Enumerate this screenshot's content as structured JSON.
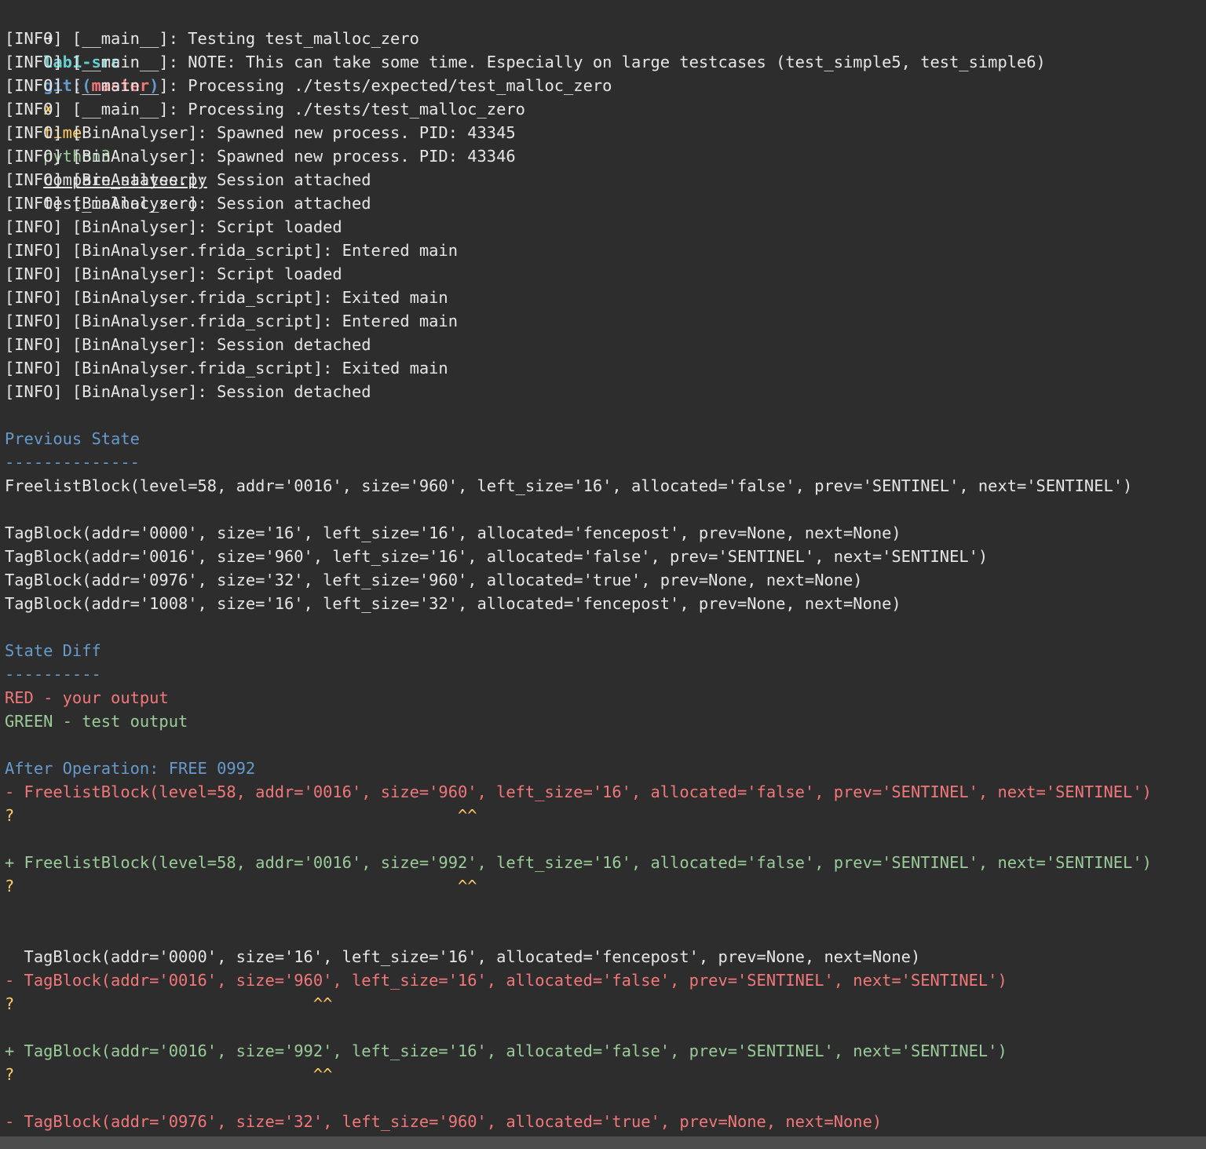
{
  "colors": {
    "background": "#2d2d2d",
    "text": "#e6e6e6",
    "heading_blue": "#6699cc",
    "diff_red": "#f2777a",
    "diff_green": "#99cc99",
    "hint_yellow": "#ffcc66",
    "prompt_cyan": "#66cccc",
    "git_blue": "#6699cc",
    "git_red": "#f2777a",
    "command_yellow": "#ffcc66",
    "python_green": "#99cc99",
    "bottom_bar": "#4d4d4d"
  },
  "prompt": {
    "arrow": "➜",
    "directory": "lab1-src",
    "git_label": "git:(",
    "branch": "master",
    "git_close": ")",
    "dirty_mark": "✗",
    "command": "time",
    "program": "python3",
    "script": "compare_states.py",
    "argument": "test_malloc_zero"
  },
  "log_lines": [
    "[INFO] [__main__]: Testing test_malloc_zero",
    "[INFO] [__main__]: NOTE: This can take some time. Especially on large testcases (test_simple5, test_simple6)",
    "[INFO] [__main__]: Processing ./tests/expected/test_malloc_zero",
    "[INFO] [__main__]: Processing ./tests/test_malloc_zero",
    "[INFO] [BinAnalyser]: Spawned new process. PID: 43345",
    "[INFO] [BinAnalyser]: Spawned new process. PID: 43346",
    "[INFO] [BinAnalyser]: Session attached",
    "[INFO] [BinAnalyser]: Session attached",
    "[INFO] [BinAnalyser]: Script loaded",
    "[INFO] [BinAnalyser.frida_script]: Entered main",
    "[INFO] [BinAnalyser]: Script loaded",
    "[INFO] [BinAnalyser.frida_script]: Exited main",
    "[INFO] [BinAnalyser.frida_script]: Entered main",
    "[INFO] [BinAnalyser]: Session detached",
    "[INFO] [BinAnalyser.frida_script]: Exited main",
    "[INFO] [BinAnalyser]: Session detached"
  ],
  "previous_state": {
    "title": "Previous State",
    "underline": "--------------",
    "freelist": [
      "FreelistBlock(level=58, addr='0016', size='960', left_size='16', allocated='false', prev='SENTINEL', next='SENTINEL')"
    ],
    "tags": [
      "TagBlock(addr='0000', size='16', left_size='16', allocated='fencepost', prev=None, next=None)",
      "TagBlock(addr='0016', size='960', left_size='16', allocated='false', prev='SENTINEL', next='SENTINEL')",
      "TagBlock(addr='0976', size='32', left_size='960', allocated='true', prev=None, next=None)",
      "TagBlock(addr='1008', size='16', left_size='32', allocated='fencepost', prev=None, next=None)"
    ]
  },
  "state_diff": {
    "title": "State Diff",
    "underline": "----------",
    "legend_red": "RED - your output",
    "legend_green": "GREEN - test output",
    "operation": "After Operation: FREE 0992",
    "freelist_removed": "- FreelistBlock(level=58, addr='0016', size='960', left_size='16', allocated='false', prev='SENTINEL', next='SENTINEL')",
    "freelist_removed_hint": "?                                              ^^",
    "freelist_added": "+ FreelistBlock(level=58, addr='0016', size='992', left_size='16', allocated='false', prev='SENTINEL', next='SENTINEL')",
    "freelist_added_hint": "?                                              ^^",
    "tag_unchanged": "  TagBlock(addr='0000', size='16', left_size='16', allocated='fencepost', prev=None, next=None)",
    "tag_removed": "- TagBlock(addr='0016', size='960', left_size='16', allocated='false', prev='SENTINEL', next='SENTINEL')",
    "tag_removed_hint": "?                               ^^",
    "tag_added": "+ TagBlock(addr='0016', size='992', left_size='16', allocated='false', prev='SENTINEL', next='SENTINEL')",
    "tag_added_hint": "?                               ^^",
    "tag_removed_2": "- TagBlock(addr='0976', size='32', left_size='960', allocated='true', prev=None, next=None)"
  }
}
